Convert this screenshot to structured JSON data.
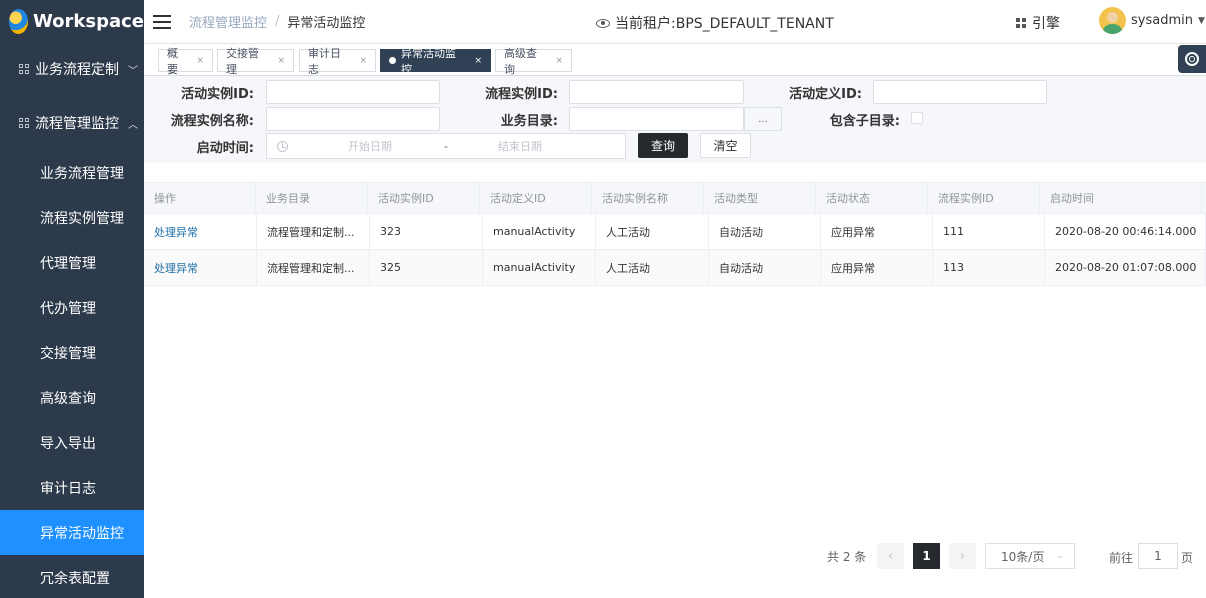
{
  "app": {
    "logo_text": "Workspace"
  },
  "sidebar": {
    "groups": [
      {
        "label": "业务流程定制",
        "caret": "﹀"
      },
      {
        "label": "流程管理监控",
        "caret": "︿"
      }
    ],
    "items": [
      {
        "label": "业务流程管理"
      },
      {
        "label": "流程实例管理"
      },
      {
        "label": "代理管理"
      },
      {
        "label": "代办管理"
      },
      {
        "label": "交接管理"
      },
      {
        "label": "高级查询"
      },
      {
        "label": "导入导出"
      },
      {
        "label": "审计日志"
      },
      {
        "label": "异常活动监控"
      },
      {
        "label": "冗余表配置"
      }
    ],
    "active_item": "异常活动监控"
  },
  "header": {
    "breadcrumb": [
      "流程管理监控",
      "异常活动监控"
    ],
    "breadcrumb_sep": "/",
    "tenant_label": "当前租户:BPS_DEFAULT_TENANT",
    "engine_label": "引擎",
    "username": "sysadmin"
  },
  "tabs": [
    {
      "label": "概要",
      "close": "×"
    },
    {
      "label": "交接管理",
      "close": "×"
    },
    {
      "label": "审计日志",
      "close": "×"
    },
    {
      "label": "异常活动监控",
      "close": "×",
      "active": true
    },
    {
      "label": "高级查询",
      "close": "×"
    }
  ],
  "form": {
    "labels": {
      "activity_instance_id": "活动实例ID:",
      "process_instance_id": "流程实例ID:",
      "activity_definition_id": "活动定义ID:",
      "process_instance_name": "流程实例名称:",
      "business_catalog": "业务目录:",
      "include_subcatalog": "包含子目录:",
      "start_time": "启动时间:"
    },
    "catalog_button": "...",
    "date_start_placeholder": "开始日期",
    "date_separator": "-",
    "date_end_placeholder": "结束日期",
    "query_button": "查询",
    "clear_button": "清空"
  },
  "table": {
    "columns": [
      "操作",
      "业务目录",
      "活动实例ID",
      "活动定义ID",
      "活动实例名称",
      "活动类型",
      "活动状态",
      "流程实例ID",
      "启动时间"
    ],
    "rows": [
      [
        "处理异常",
        "流程管理和定制...",
        "323",
        "manualActivity",
        "人工活动",
        "自动活动",
        "应用异常",
        "111",
        "2020-08-20 00:46:14.000"
      ],
      [
        "处理异常",
        "流程管理和定制...",
        "325",
        "manualActivity",
        "人工活动",
        "自动活动",
        "应用异常",
        "113",
        "2020-08-20 01:07:08.000"
      ]
    ]
  },
  "pagination": {
    "total": "共 2 条",
    "prev": "‹",
    "current_page": "1",
    "next": "›",
    "page_size": "10条/页",
    "page_size_chevron": "⌄",
    "goto_label": "前往",
    "goto_value": "1",
    "page_suffix": "页"
  },
  "colors": {
    "sidebar_bg": "#2d3a4b",
    "sidebar_active": "#1e90ff",
    "tab_active": "#304156",
    "primary_button": "#262a2f",
    "link": "#1d6fa5"
  }
}
